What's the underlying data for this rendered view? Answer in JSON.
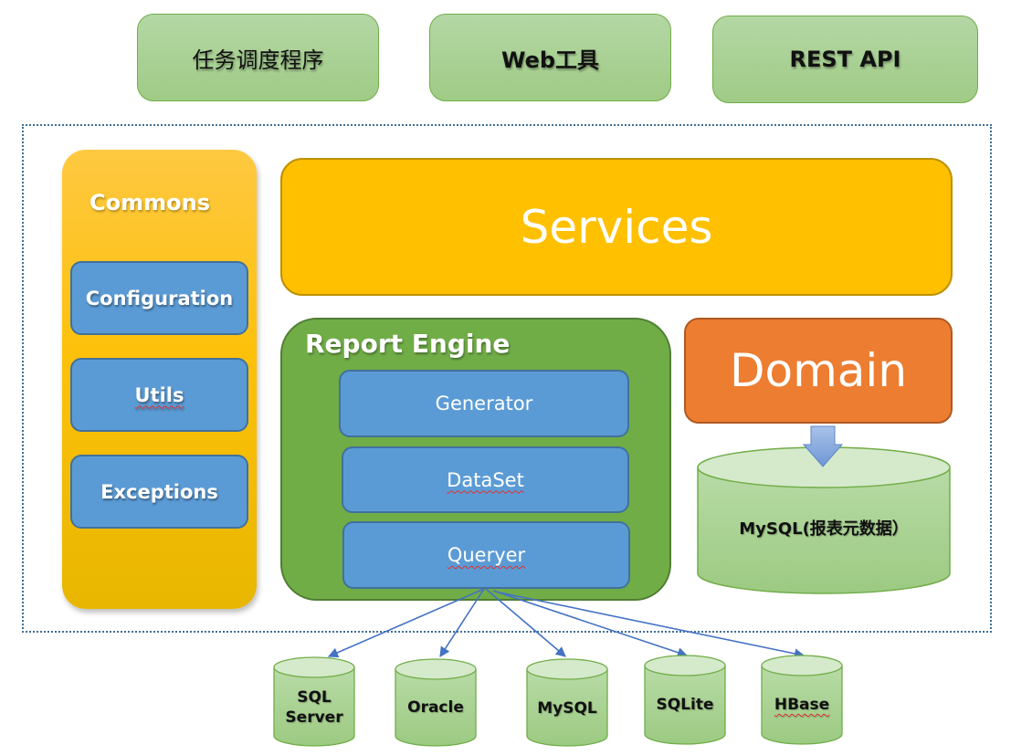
{
  "top_layer": {
    "scheduler": "任务调度程序",
    "web_tool": "Web工具",
    "rest_api": "REST API"
  },
  "commons": {
    "title": "Commons",
    "items": [
      "Configuration",
      "Utils",
      "Exceptions"
    ]
  },
  "services": {
    "label": "Services"
  },
  "report_engine": {
    "title": "Report Engine",
    "items": [
      "Generator",
      "DataSet",
      "Queryer"
    ]
  },
  "domain": {
    "label": "Domain"
  },
  "metadata_db": {
    "label": "MySQL(报表元数据）"
  },
  "datasources": [
    {
      "line1": "SQL",
      "line2": "Server"
    },
    {
      "line1": "Oracle",
      "line2": ""
    },
    {
      "line1": "MySQL",
      "line2": ""
    },
    {
      "line1": "SQLite",
      "line2": ""
    },
    {
      "line1": "HBase",
      "line2": ""
    }
  ],
  "colors": {
    "top_green": "#a9d18e",
    "commons_yellow": "#fdc10a",
    "blue": "#5b9bd5",
    "services_yellow": "#ffc000",
    "engine_green": "#70ad47",
    "domain_orange": "#ed7d31",
    "db_green": "#a9d18e",
    "arrow_blue": "#4472c4"
  }
}
